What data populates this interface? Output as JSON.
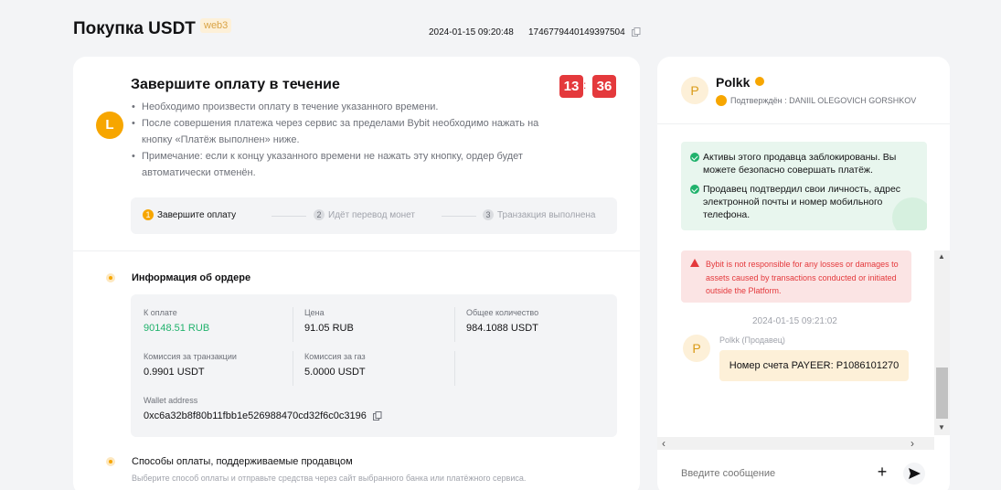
{
  "header": {
    "title": "Покупка USDT",
    "badge": "web3",
    "timestamp": "2024-01-15 09:20:48",
    "order_id": "1746779440149397504"
  },
  "payment": {
    "avatar_letter": "L",
    "title": "Завершите оплату в течение",
    "timer_minutes": "13",
    "timer_seconds": "36",
    "timer_separator": ":",
    "notes": [
      "Необходимо произвести оплату в течение указанного времени.",
      "После совершения платежа через сервис за пределами Bybit необходимо нажать на кнопку «Платёж выполнен» ниже.",
      "Примечание: если к концу указанного времени не нажать эту кнопку, ордер будет автоматически отменён."
    ],
    "steps": [
      {
        "num": "1",
        "label": "Завершите оплату"
      },
      {
        "num": "2",
        "label": "Идёт перевод монет"
      },
      {
        "num": "3",
        "label": "Транзакция выполнена"
      }
    ]
  },
  "order_info": {
    "title": "Информация об ордере",
    "to_pay_label": "К оплате",
    "to_pay_value": "90148.51 RUB",
    "price_label": "Цена",
    "price_value": "91.05 RUB",
    "total_label": "Общее количество",
    "total_value": "984.1088 USDT",
    "fee_label": "Комиссия за транзакции",
    "fee_value": "0.9901 USDT",
    "gas_label": "Комиссия за газ",
    "gas_value": "5.0000 USDT",
    "wallet_label": "Wallet address",
    "wallet_value": "0xc6a32b8f80b11fbb1e526988470cd32f6c0c3196"
  },
  "payment_methods": {
    "title": "Способы оплаты, поддерживаемые продавцом",
    "subtitle": "Выберите способ оплаты и отправьте средства через сайт выбранного банка или платёжного сервиса."
  },
  "chat": {
    "seller_avatar": "P",
    "seller_name": "Polkk",
    "verified_text": "Подтверждён : DANIIL OLEGOVICH GORSHKOV",
    "notice_1": "Активы этого продавца заблокированы. Вы можете безопасно совершать платёж.",
    "notice_2": "Продавец подтвердил свои личность, адрес электронной почты и номер мобильного телефона.",
    "warning": "Bybit is not responsible for any losses or damages to assets caused by transactions conducted or initiated outside the Platform.",
    "message_time": "2024-01-15 09:21:02",
    "message_sender": "Polkk (Продавец)",
    "message_text": "Номер счета PAYEER: P1086101270",
    "input_placeholder": "Введите сообщение"
  },
  "colors": {
    "accent": "#f7a600",
    "timer": "#e4393c",
    "success": "#20b26c"
  }
}
